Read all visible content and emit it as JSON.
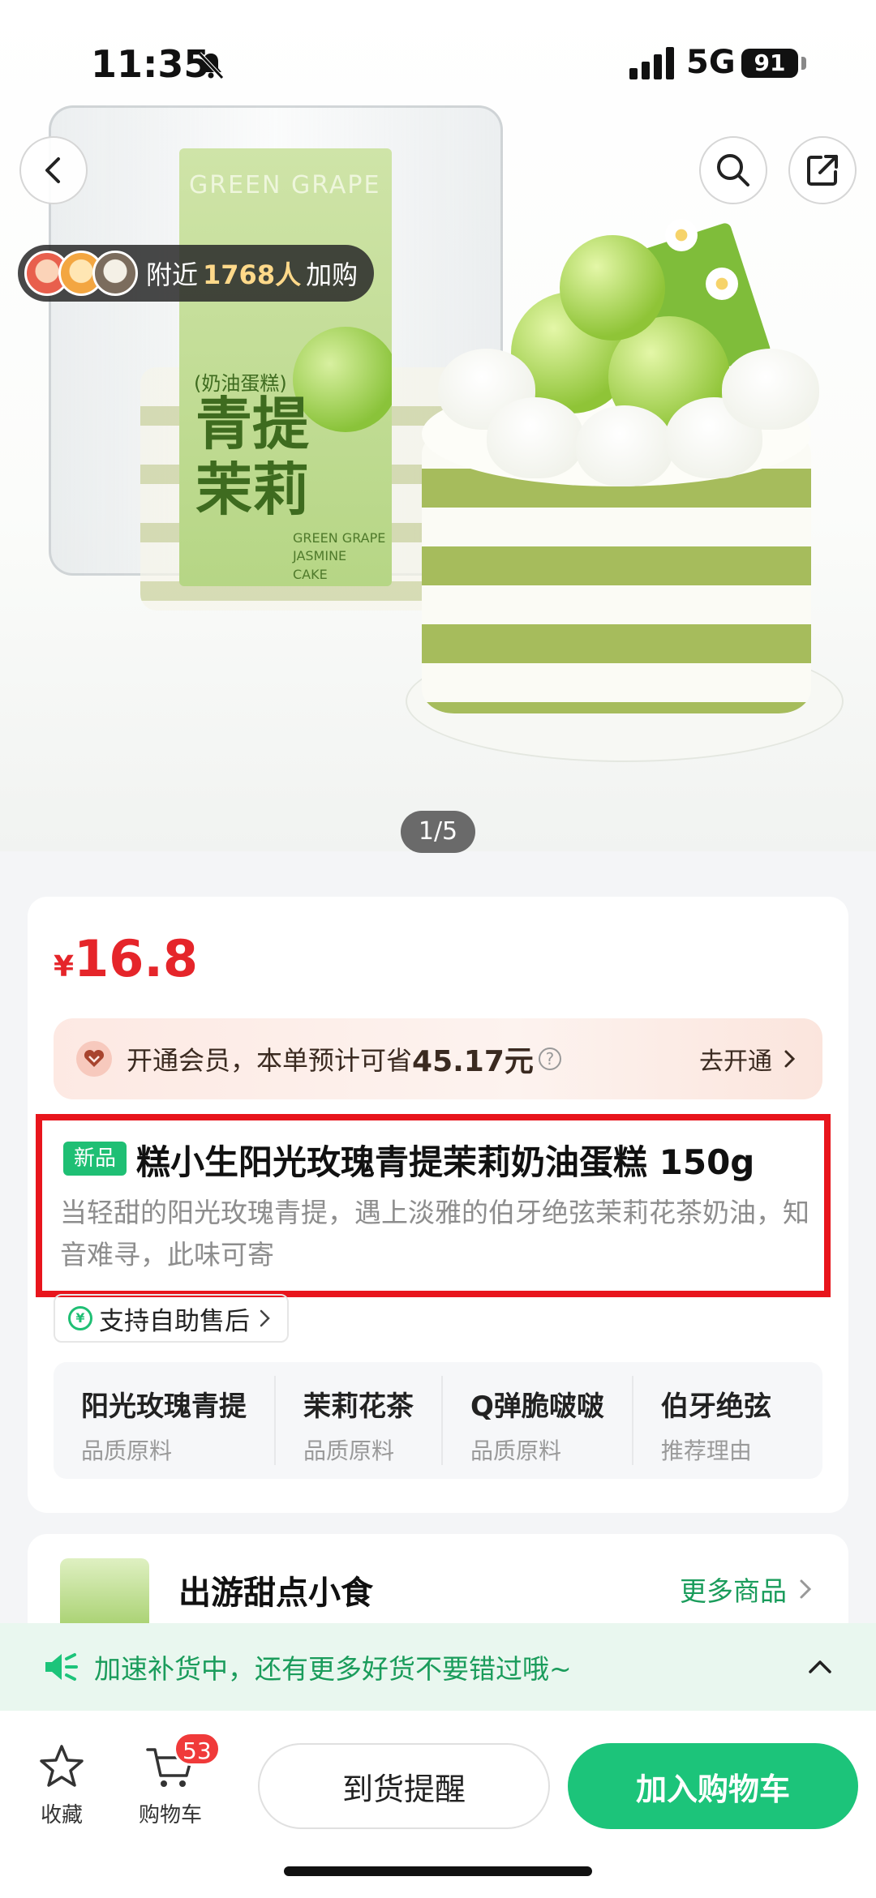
{
  "status_bar": {
    "time": "11:35",
    "network": "5G",
    "battery": "91"
  },
  "hero": {
    "nearby_prefix": "附近",
    "nearby_count": "1768人",
    "nearby_suffix": "加购",
    "pager": "1/5",
    "package_label": {
      "title": "GREEN GRAPE",
      "sub": "(奶油蛋糕)",
      "name_line1": "青提",
      "name_line2": "茉莉",
      "foot": "GREEN GRAPE\nJASMINE\nCAKE"
    }
  },
  "price": {
    "symbol": "¥",
    "value": "16.8"
  },
  "member": {
    "text": "开通会员，本单预计可省",
    "amount": "45.17元",
    "help": "?",
    "cta": "去开通"
  },
  "product": {
    "tag": "新品",
    "title": "糕小生阳光玫瑰青提茉莉奶油蛋糕 150g",
    "description": "当轻甜的阳光玫瑰青提，遇上淡雅的伯牙绝弦茉莉花茶奶油，知音难寻，此味可寄"
  },
  "aftersale": {
    "icon_text": "¥",
    "label": "支持自助售后"
  },
  "features": [
    {
      "title": "阳光玫瑰青提",
      "sub": "品质原料"
    },
    {
      "title": "茉莉花茶",
      "sub": "品质原料"
    },
    {
      "title": "Q弹脆啵啵",
      "sub": "品质原料"
    },
    {
      "title": "伯牙绝弦",
      "sub": "推荐理由"
    }
  ],
  "more": {
    "title": "出游甜点小食",
    "link": "更多商品"
  },
  "restock": {
    "text": "加速补货中，还有更多好货不要错过哦~"
  },
  "bottom": {
    "fav_label": "收藏",
    "cart_label": "购物车",
    "cart_badge": "53",
    "remind_label": "到货提醒",
    "add_cart_label": "加入购物车"
  },
  "colors": {
    "price": "#e5252a",
    "accent_green": "#1cc47a",
    "highlight_box": "#e8151c"
  }
}
